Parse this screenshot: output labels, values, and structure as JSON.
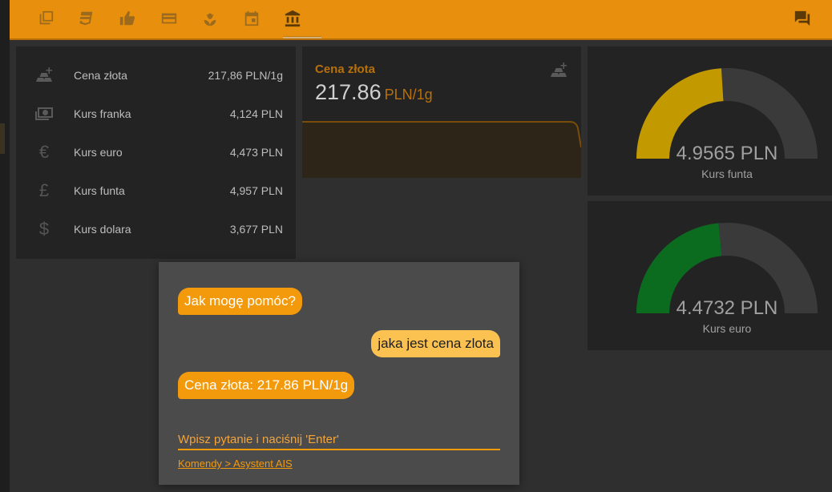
{
  "topbar": {
    "icons": [
      {
        "name": "copy-icon"
      },
      {
        "name": "css3-icon"
      },
      {
        "name": "thumbs-up-icon"
      },
      {
        "name": "credit-card-icon"
      },
      {
        "name": "flower-icon"
      },
      {
        "name": "calendar-icon"
      },
      {
        "name": "bank-icon",
        "active": true
      }
    ],
    "right_icon": "chat-icon",
    "accent": "#e8900d"
  },
  "rates": [
    {
      "icon": "gold-bars-icon",
      "label": "Cena złota",
      "value": "217,86 PLN/1g"
    },
    {
      "icon": "banknote-icon",
      "label": "Kurs franka",
      "value": "4,124 PLN"
    },
    {
      "icon": "euro-icon",
      "label": "Kurs euro",
      "value": "4,473 PLN"
    },
    {
      "icon": "pound-icon",
      "label": "Kurs funta",
      "value": "4,957 PLN"
    },
    {
      "icon": "dollar-icon",
      "label": "Kurs dolara",
      "value": "3,677 PLN"
    }
  ],
  "gold": {
    "title": "Cena złota",
    "value": "217.86",
    "unit": "PLN/1g"
  },
  "gauges": [
    {
      "value_text": "4.9565 PLN",
      "label": "Kurs funta",
      "fraction": 0.48,
      "color": "#c29a00"
    },
    {
      "value_text": "4.4732 PLN",
      "label": "Kurs euro",
      "fraction": 0.47,
      "color": "#0b6b1f"
    }
  ],
  "chat": {
    "messages": [
      {
        "from": "bot",
        "text": "Jak mogę pomóc?"
      },
      {
        "from": "user",
        "text": "jaka jest cena zlota"
      },
      {
        "from": "bot",
        "text": "Cena złota: 217.86 PLN/1g"
      }
    ],
    "input_placeholder": "Wpisz pytanie i naciśnij 'Enter'",
    "link_text": "Komendy > Asystent AIS"
  }
}
